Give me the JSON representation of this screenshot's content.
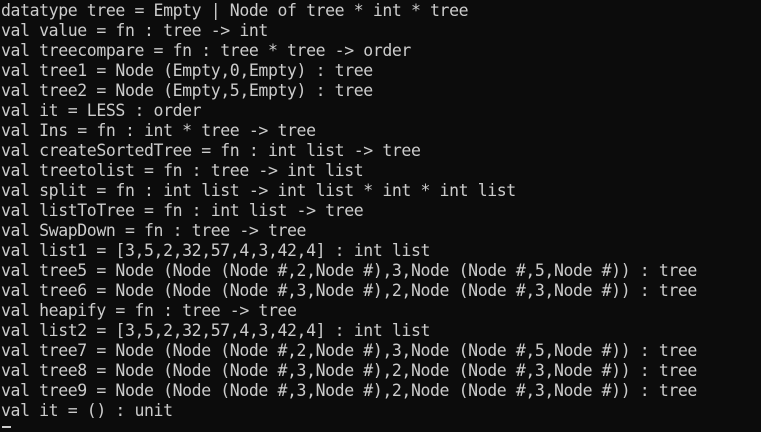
{
  "terminal": {
    "lines": [
      "datatype tree = Empty | Node of tree * int * tree",
      "val value = fn : tree -> int",
      "val treecompare = fn : tree * tree -> order",
      "val tree1 = Node (Empty,0,Empty) : tree",
      "val tree2 = Node (Empty,5,Empty) : tree",
      "val it = LESS : order",
      "val Ins = fn : int * tree -> tree",
      "val createSortedTree = fn : int list -> tree",
      "val treetolist = fn : tree -> int list",
      "val split = fn : int list -> int list * int * int list",
      "val listToTree = fn : int list -> tree",
      "val SwapDown = fn : tree -> tree",
      "val list1 = [3,5,2,32,57,4,3,42,4] : int list",
      "val tree5 = Node (Node (Node #,2,Node #),3,Node (Node #,5,Node #)) : tree",
      "val tree6 = Node (Node (Node #,3,Node #),2,Node (Node #,3,Node #)) : tree",
      "val heapify = fn : tree -> tree",
      "val list2 = [3,5,2,32,57,4,3,42,4] : int list",
      "val tree7 = Node (Node (Node #,2,Node #),3,Node (Node #,5,Node #)) : tree",
      "val tree8 = Node (Node (Node #,3,Node #),2,Node (Node #,3,Node #)) : tree",
      "val tree9 = Node (Node (Node #,3,Node #),2,Node (Node #,3,Node #)) : tree",
      "val it = () : unit"
    ]
  },
  "colors": {
    "background": "#0c0c0c",
    "foreground": "#cccccc"
  }
}
